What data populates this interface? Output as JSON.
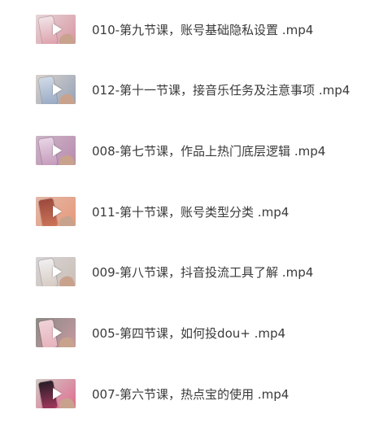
{
  "files": [
    {
      "name": "010-第九节课，账号基础隐私设置 .mp4",
      "thumb": {
        "bg": "#e6d6d8",
        "phone": "#f1e2e6",
        "accent": "#d27a8a",
        "icon": "play-icon"
      }
    },
    {
      "name": "012-第十一节课，接音乐任务及注意事项 .mp4",
      "thumb": {
        "bg": "#d8d2cc",
        "phone": "#cfd9e6",
        "accent": "#7a8fb0",
        "icon": "play-icon"
      }
    },
    {
      "name": "008-第七节课，作品上热门底层逻辑 .mp4",
      "thumb": {
        "bg": "#cdb5c8",
        "phone": "#e7d3e3",
        "accent": "#b07aa4",
        "icon": "play-icon"
      }
    },
    {
      "name": "011-第十节课，账号类型分类 .mp4",
      "thumb": {
        "bg": "#e2b8a8",
        "phone": "#9c4a3e",
        "accent": "#e98c68",
        "icon": "play-icon"
      }
    },
    {
      "name": "009-第八节课，抖音投流工具了解 .mp4",
      "thumb": {
        "bg": "#d6d4d6",
        "phone": "#f0eef0",
        "accent": "#c8b6a8",
        "icon": "play-icon"
      }
    },
    {
      "name": "005-第四节课，如何投dou+ .mp4",
      "thumb": {
        "bg": "#8c8a86",
        "phone": "#f0d2d8",
        "accent": "#e0a0ac",
        "icon": "play-icon"
      }
    },
    {
      "name": "007-第六节课，热点宝的使用 .mp4",
      "thumb": {
        "bg": "#cfc9c4",
        "phone": "#2a1e28",
        "accent": "#e8457a",
        "icon": "play-icon"
      }
    }
  ]
}
